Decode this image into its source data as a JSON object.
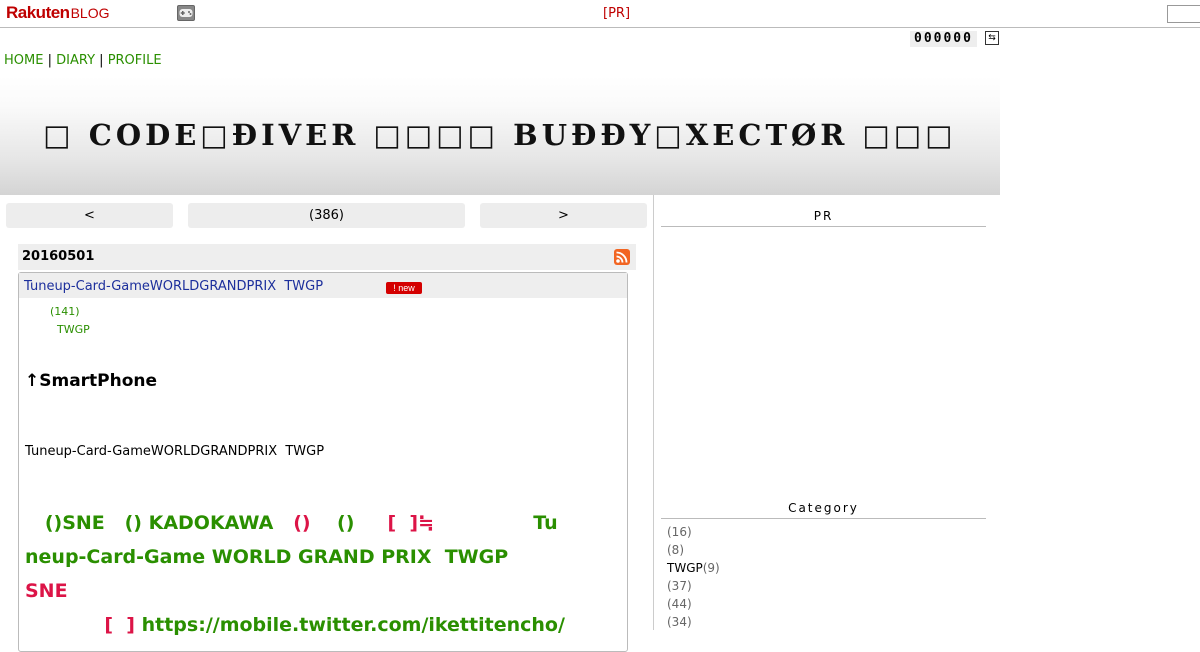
{
  "topbar": {
    "logo_brand": "Rakuten",
    "logo_suffix": "BLOG",
    "pr_link": "[PR]"
  },
  "counter": {
    "value": "000000"
  },
  "nav": {
    "items": [
      {
        "label": "HOME"
      },
      {
        "label": "DIARY"
      },
      {
        "label": "PROFILE"
      }
    ],
    "separator": "|"
  },
  "banner": {
    "title": "□ CODE□ĐIVER □□□□ BUĐĐY□XECTØR □□□"
  },
  "pager": {
    "prev": "<",
    "list": "(386)",
    "next": ">"
  },
  "post": {
    "date": "20160501",
    "title": "Tuneup-Card-GameWORLDGRANDPRIX  TWGP",
    "badge": "new",
    "count": "(141)",
    "tag": "TWGP",
    "smartphone": "↑SmartPhone",
    "line": "Tuneup-Card-GameWORLDGRANDPRIX  TWGP",
    "big1_a": "   ()SNE   () KADOKAWA   ",
    "big1_b": "()",
    "big1_c": "    ()     ",
    "big1_d": "[  ]≒",
    "big1_e": "               Tu",
    "big2": "neup-Card-Game WORLD GRAND PRIX  TWGP",
    "big3": "SNE",
    "big4_a": "            ",
    "big4_b": "[  ]",
    "big4_c": " https://mobile.twitter.com/ikettitencho/"
  },
  "sidebar": {
    "pr_heading": "PR",
    "category_heading": "Category",
    "categories": [
      {
        "name": "",
        "count": "(16)"
      },
      {
        "name": "",
        "count": "(8)"
      },
      {
        "name": "TWGP",
        "count": "(9)"
      },
      {
        "name": "",
        "count": "(37)"
      },
      {
        "name": "",
        "count": "(44)"
      },
      {
        "name": "",
        "count": "(34)"
      }
    ]
  },
  "colors": {
    "brand_red": "#bf0000",
    "link_green": "#2a8f00",
    "accent_crimson": "#dc1447",
    "title_blue": "#1c2f9c"
  }
}
